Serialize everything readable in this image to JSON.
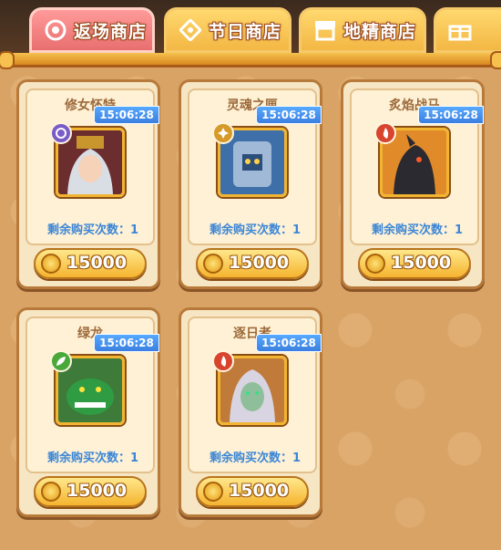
{
  "tabs": [
    {
      "label": "返场商店",
      "icon": "target-icon",
      "active": true
    },
    {
      "label": "节日商店",
      "icon": "diamond-compass-icon",
      "active": false
    },
    {
      "label": "地精商店",
      "icon": "shop-stall-icon",
      "active": false
    },
    {
      "label": "",
      "icon": "gift-icon",
      "active": false
    }
  ],
  "items": [
    {
      "name": "修女怀特",
      "timer": "15:06:28",
      "remaining": "剩余购买次数：1",
      "price": "15000",
      "element": "purple"
    },
    {
      "name": "灵魂之匣",
      "timer": "15:06:28",
      "remaining": "剩余购买次数：1",
      "price": "15000",
      "element": "gold"
    },
    {
      "name": "炙焰战马",
      "timer": "15:06:28",
      "remaining": "剩余购买次数：1",
      "price": "15000",
      "element": "red"
    },
    {
      "name": "绿龙",
      "timer": "15:06:28",
      "remaining": "剩余购买次数：1",
      "price": "15000",
      "element": "green"
    },
    {
      "name": "逐日者",
      "timer": "15:06:28",
      "remaining": "剩余购买次数：1",
      "price": "15000",
      "element": "red"
    }
  ]
}
